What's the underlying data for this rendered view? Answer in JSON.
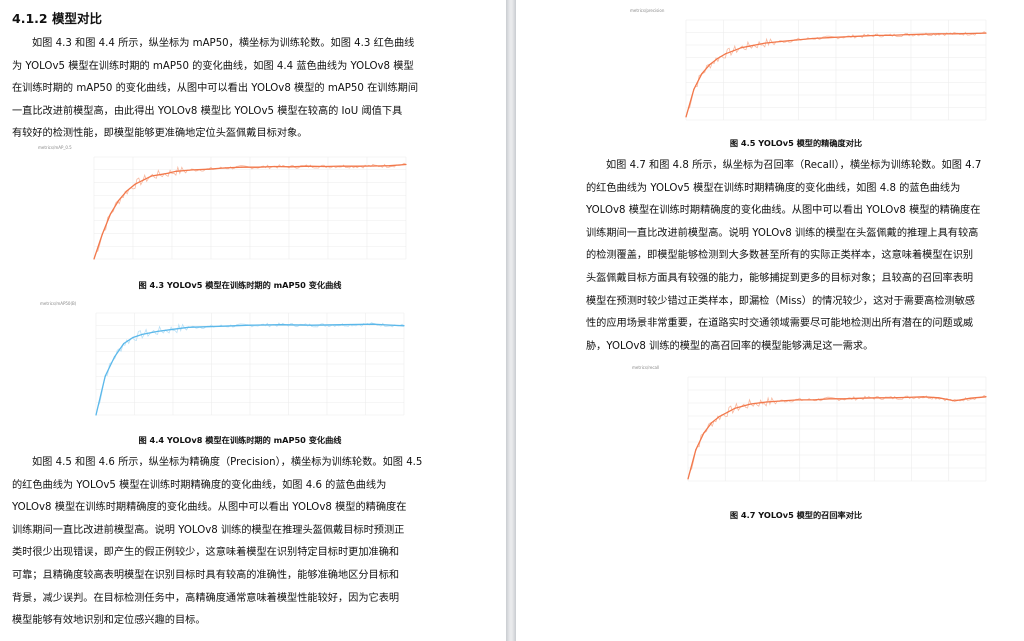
{
  "left_page": {
    "heading": "4.1.2 模型对比",
    "para1_lines": [
      "如图 4.3 和图 4.4 所示，纵坐标为 mAP50，横坐标为训练轮数。如图 4.3 红色曲线",
      "为 YOLOv5 模型在训练时期的 mAP50 的变化曲线，如图 4.4 蓝色曲线为 YOLOv8 模型",
      "在训练时期的 mAP50 的变化曲线，从图中可以看出 YOLOv8 模型的 mAP50 在训练期间",
      "一直比改进前模型高，由此得出 YOLOv8 模型比 YOLOv5 模型在较高的 IoU 阈值下具",
      "有较好的检测性能，即模型能够更准确地定位头盔佩戴目标对象。"
    ],
    "caption_43": "图 4.3 YOLOv5 模型在训练时期的 mAP50 变化曲线",
    "caption_44": "图 4.4 YOLOv8 模型在训练时期的 mAP50 变化曲线",
    "para2_lines": [
      "如图 4.5 和图 4.6 所示，纵坐标为精确度（Precision），横坐标为训练轮数。如图 4.5",
      "的红色曲线为 YOLOv5 模型在训练时期精确度的变化曲线，如图 4.6 的蓝色曲线为",
      "YOLOv8 模型在训练时期精确度的变化曲线。从图中可以看出 YOLOv8 模型的精确度在",
      "训练期间一直比改进前模型高。说明 YOLOv8 训练的模型在推理头盔佩戴目标时预测正",
      "类时很少出现错误，即产生的假正例较少，这意味着模型在识别特定目标时更加准确和",
      "可靠；且精确度较高表明模型在识别目标时具有较高的准确性，能够准确地区分目标和",
      "背景，减少误判。在目标检测任务中，高精确度通常意味着模型性能较好，因为它表明",
      "模型能够有效地识别和定位感兴趣的目标。"
    ]
  },
  "right_page": {
    "caption_45": "图 4.5 YOLOv5 模型的精确度对比",
    "para_lines": [
      "如图 4.7 和图 4.8 所示，纵坐标为召回率（Recall），横坐标为训练轮数。如图 4.7",
      "的红色曲线为 YOLOv5 模型在训练时期精确度的变化曲线，如图 4.8 的蓝色曲线为",
      "YOLOv8 模型在训练时期精确度的变化曲线。从图中可以看出 YOLOv8 模型的精确度在",
      "训练期间一直比改进前模型高。说明 YOLOv8 训练的模型在头盔佩戴的推理上具有较高",
      "的检测覆盖，即模型能够检测到大多数甚至所有的实际正类样本，这意味着模型在识别",
      "头盔佩戴目标方面具有较强的能力，能够捕捉到更多的目标对象；且较高的召回率表明",
      "模型在预测时较少错过正类样本，即漏检（Miss）的情况较少，这对于需要高检测敏感",
      "性的应用场景非常重要，在道路实时交通领域需要尽可能地检测出所有潜在的问题或威",
      "胁，YOLOv8 训练的模型的高召回率的模型能够满足这一需求。"
    ],
    "caption_47": "图 4.7 YOLOv5 模型的召回率对比"
  },
  "colors": {
    "red_curve": "#f2784b",
    "red_curve_faint": "#f7b9a1",
    "blue_curve": "#5bb8ea",
    "blue_curve_faint": "#b9e0f6",
    "grid": "#ececec"
  },
  "chart_data": [
    {
      "id": "fig4.3",
      "type": "line",
      "title": "metrics/mAP_0.5",
      "ylim": [
        0,
        0.75
      ],
      "x": [
        0,
        5,
        10,
        15,
        20,
        25,
        30,
        35,
        40,
        45,
        50,
        60,
        70,
        80,
        90,
        100,
        110,
        120,
        130,
        140,
        150,
        160,
        170,
        180,
        190
      ],
      "y": [
        0.0,
        0.18,
        0.33,
        0.43,
        0.5,
        0.55,
        0.58,
        0.61,
        0.62,
        0.63,
        0.645,
        0.655,
        0.66,
        0.67,
        0.675,
        0.675,
        0.68,
        0.678,
        0.682,
        0.68,
        0.683,
        0.682,
        0.684,
        0.686,
        0.695
      ],
      "color": "red"
    },
    {
      "id": "fig4.4",
      "type": "line",
      "title": "metrics/mAP50(B)",
      "ylim": [
        0,
        1.0
      ],
      "x": [
        0,
        3,
        6,
        9,
        12,
        15,
        20,
        25,
        30,
        40,
        50,
        60,
        70,
        80,
        90,
        100
      ],
      "y": [
        0.0,
        0.38,
        0.57,
        0.7,
        0.76,
        0.79,
        0.82,
        0.84,
        0.86,
        0.87,
        0.88,
        0.885,
        0.88,
        0.885,
        0.89,
        0.875
      ],
      "color": "blue"
    },
    {
      "id": "fig4.5",
      "type": "line",
      "title": "metrics/precision",
      "ylim": [
        0.3,
        0.95
      ],
      "x": [
        0,
        5,
        10,
        15,
        20,
        25,
        30,
        35,
        40,
        50,
        60,
        70,
        80,
        90,
        100,
        110,
        120,
        130,
        140,
        150,
        160,
        170,
        180,
        190
      ],
      "y": [
        0.32,
        0.5,
        0.6,
        0.66,
        0.7,
        0.73,
        0.75,
        0.77,
        0.78,
        0.8,
        0.81,
        0.82,
        0.83,
        0.835,
        0.84,
        0.845,
        0.85,
        0.85,
        0.855,
        0.858,
        0.86,
        0.86,
        0.862,
        0.865
      ],
      "color": "red"
    },
    {
      "id": "fig4.7",
      "type": "line",
      "title": "metrics/recall",
      "ylim": [
        0.35,
        0.85
      ],
      "x": [
        0,
        5,
        10,
        15,
        20,
        25,
        30,
        35,
        40,
        50,
        60,
        70,
        80,
        90,
        100,
        110,
        120,
        130,
        140,
        150,
        160,
        170,
        180,
        190
      ],
      "y": [
        0.36,
        0.5,
        0.58,
        0.63,
        0.66,
        0.68,
        0.7,
        0.71,
        0.72,
        0.73,
        0.735,
        0.74,
        0.74,
        0.745,
        0.745,
        0.748,
        0.75,
        0.75,
        0.752,
        0.755,
        0.75,
        0.735,
        0.748,
        0.755
      ],
      "color": "red"
    }
  ]
}
